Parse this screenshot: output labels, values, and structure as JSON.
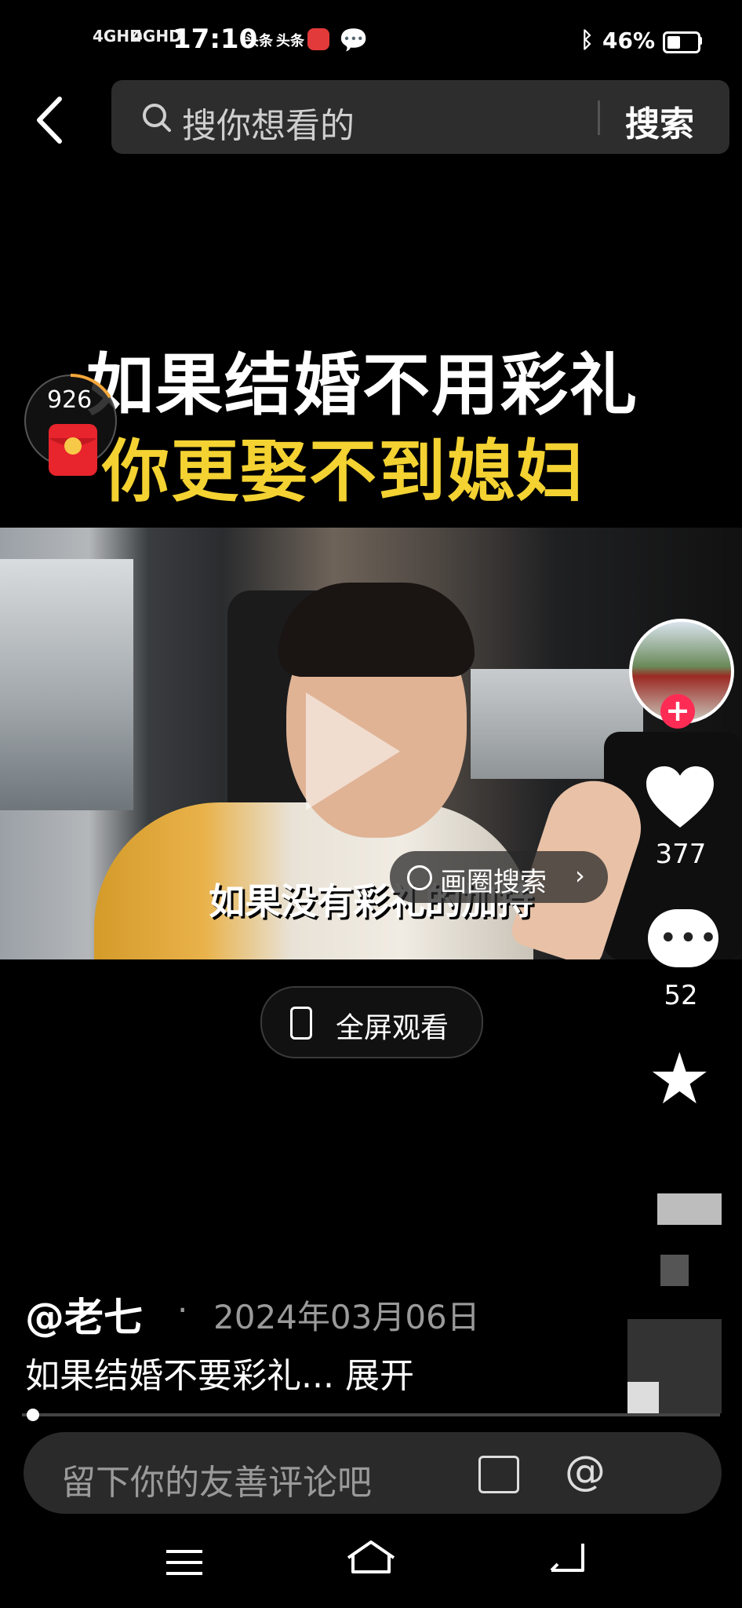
{
  "status_bar": {
    "signal_1": "4GHD",
    "signal_2": "4GHD",
    "time": "17:10",
    "app_badge_1": "头条",
    "app_badge_2": "头条",
    "battery": "46%",
    "battery_level": 0.46
  },
  "search": {
    "placeholder": "搜你想看的",
    "button": "搜索"
  },
  "video": {
    "title_line1": "如果结婚不用彩礼",
    "title_line2": "你更娶不到媳妇",
    "subtitle": "如果没有彩礼的加持",
    "circle_search": "画圈搜索",
    "fullscreen": "全屏观看"
  },
  "red_envelope": {
    "count": "926"
  },
  "rail": {
    "likes": "377",
    "comments": "52"
  },
  "post": {
    "author": "@老七",
    "separator": "·",
    "date": "2024年03月06日",
    "caption": "如果结婚不要彩礼... 展开",
    "progress": 0.01
  },
  "comment_bar": {
    "placeholder": "留下你的友善评论吧"
  },
  "colors": {
    "accent": "#fe2c55",
    "title_yellow": "#f3d232"
  }
}
